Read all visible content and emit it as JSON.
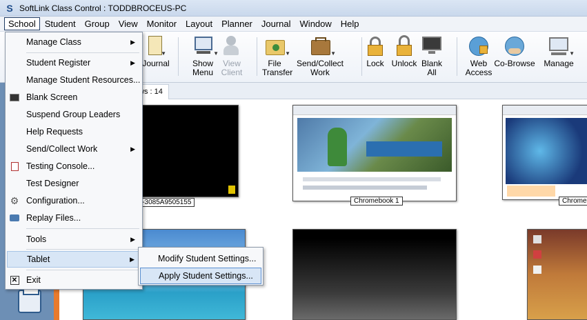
{
  "window": {
    "title": "SoftLink Class Control : TODDBROCEUS-PC"
  },
  "menubar": [
    "School",
    "Student",
    "Group",
    "View",
    "Monitor",
    "Layout",
    "Planner",
    "Journal",
    "Window",
    "Help"
  ],
  "toolbar": {
    "journal": "Journal",
    "show_menu": "Show Menu",
    "view_client": "View Client",
    "file_transfer": "File Transfer",
    "send_collect": "Send/Collect Work",
    "lock": "Lock",
    "unlock": "Unlock",
    "blank_all": "Blank All",
    "web_access": "Web Access",
    "co_browse": "Co-Browse",
    "manage": "Manage"
  },
  "tab": {
    "label": "ws : 14"
  },
  "school_menu": {
    "manage_class": "Manage Class",
    "student_register": "Student Register",
    "manage_student_resources": "Manage Student Resources...",
    "blank_screen": "Blank Screen",
    "suspend_group_leaders": "Suspend Group Leaders",
    "help_requests": "Help Requests",
    "send_collect_work": "Send/Collect Work",
    "testing_console": "Testing Console...",
    "test_designer": "Test Designer",
    "configuration": "Configuration...",
    "replay_files": "Replay Files...",
    "tools": "Tools",
    "tablet": "Tablet",
    "exit": "Exit"
  },
  "tablet_submenu": {
    "modify": "Modify Student Settings...",
    "apply": "Apply Student Settings..."
  },
  "thumbnails": {
    "t1_label": "D-3085A9505155",
    "t2_label": "Chromebook 1",
    "t3_label": "Chrome"
  }
}
